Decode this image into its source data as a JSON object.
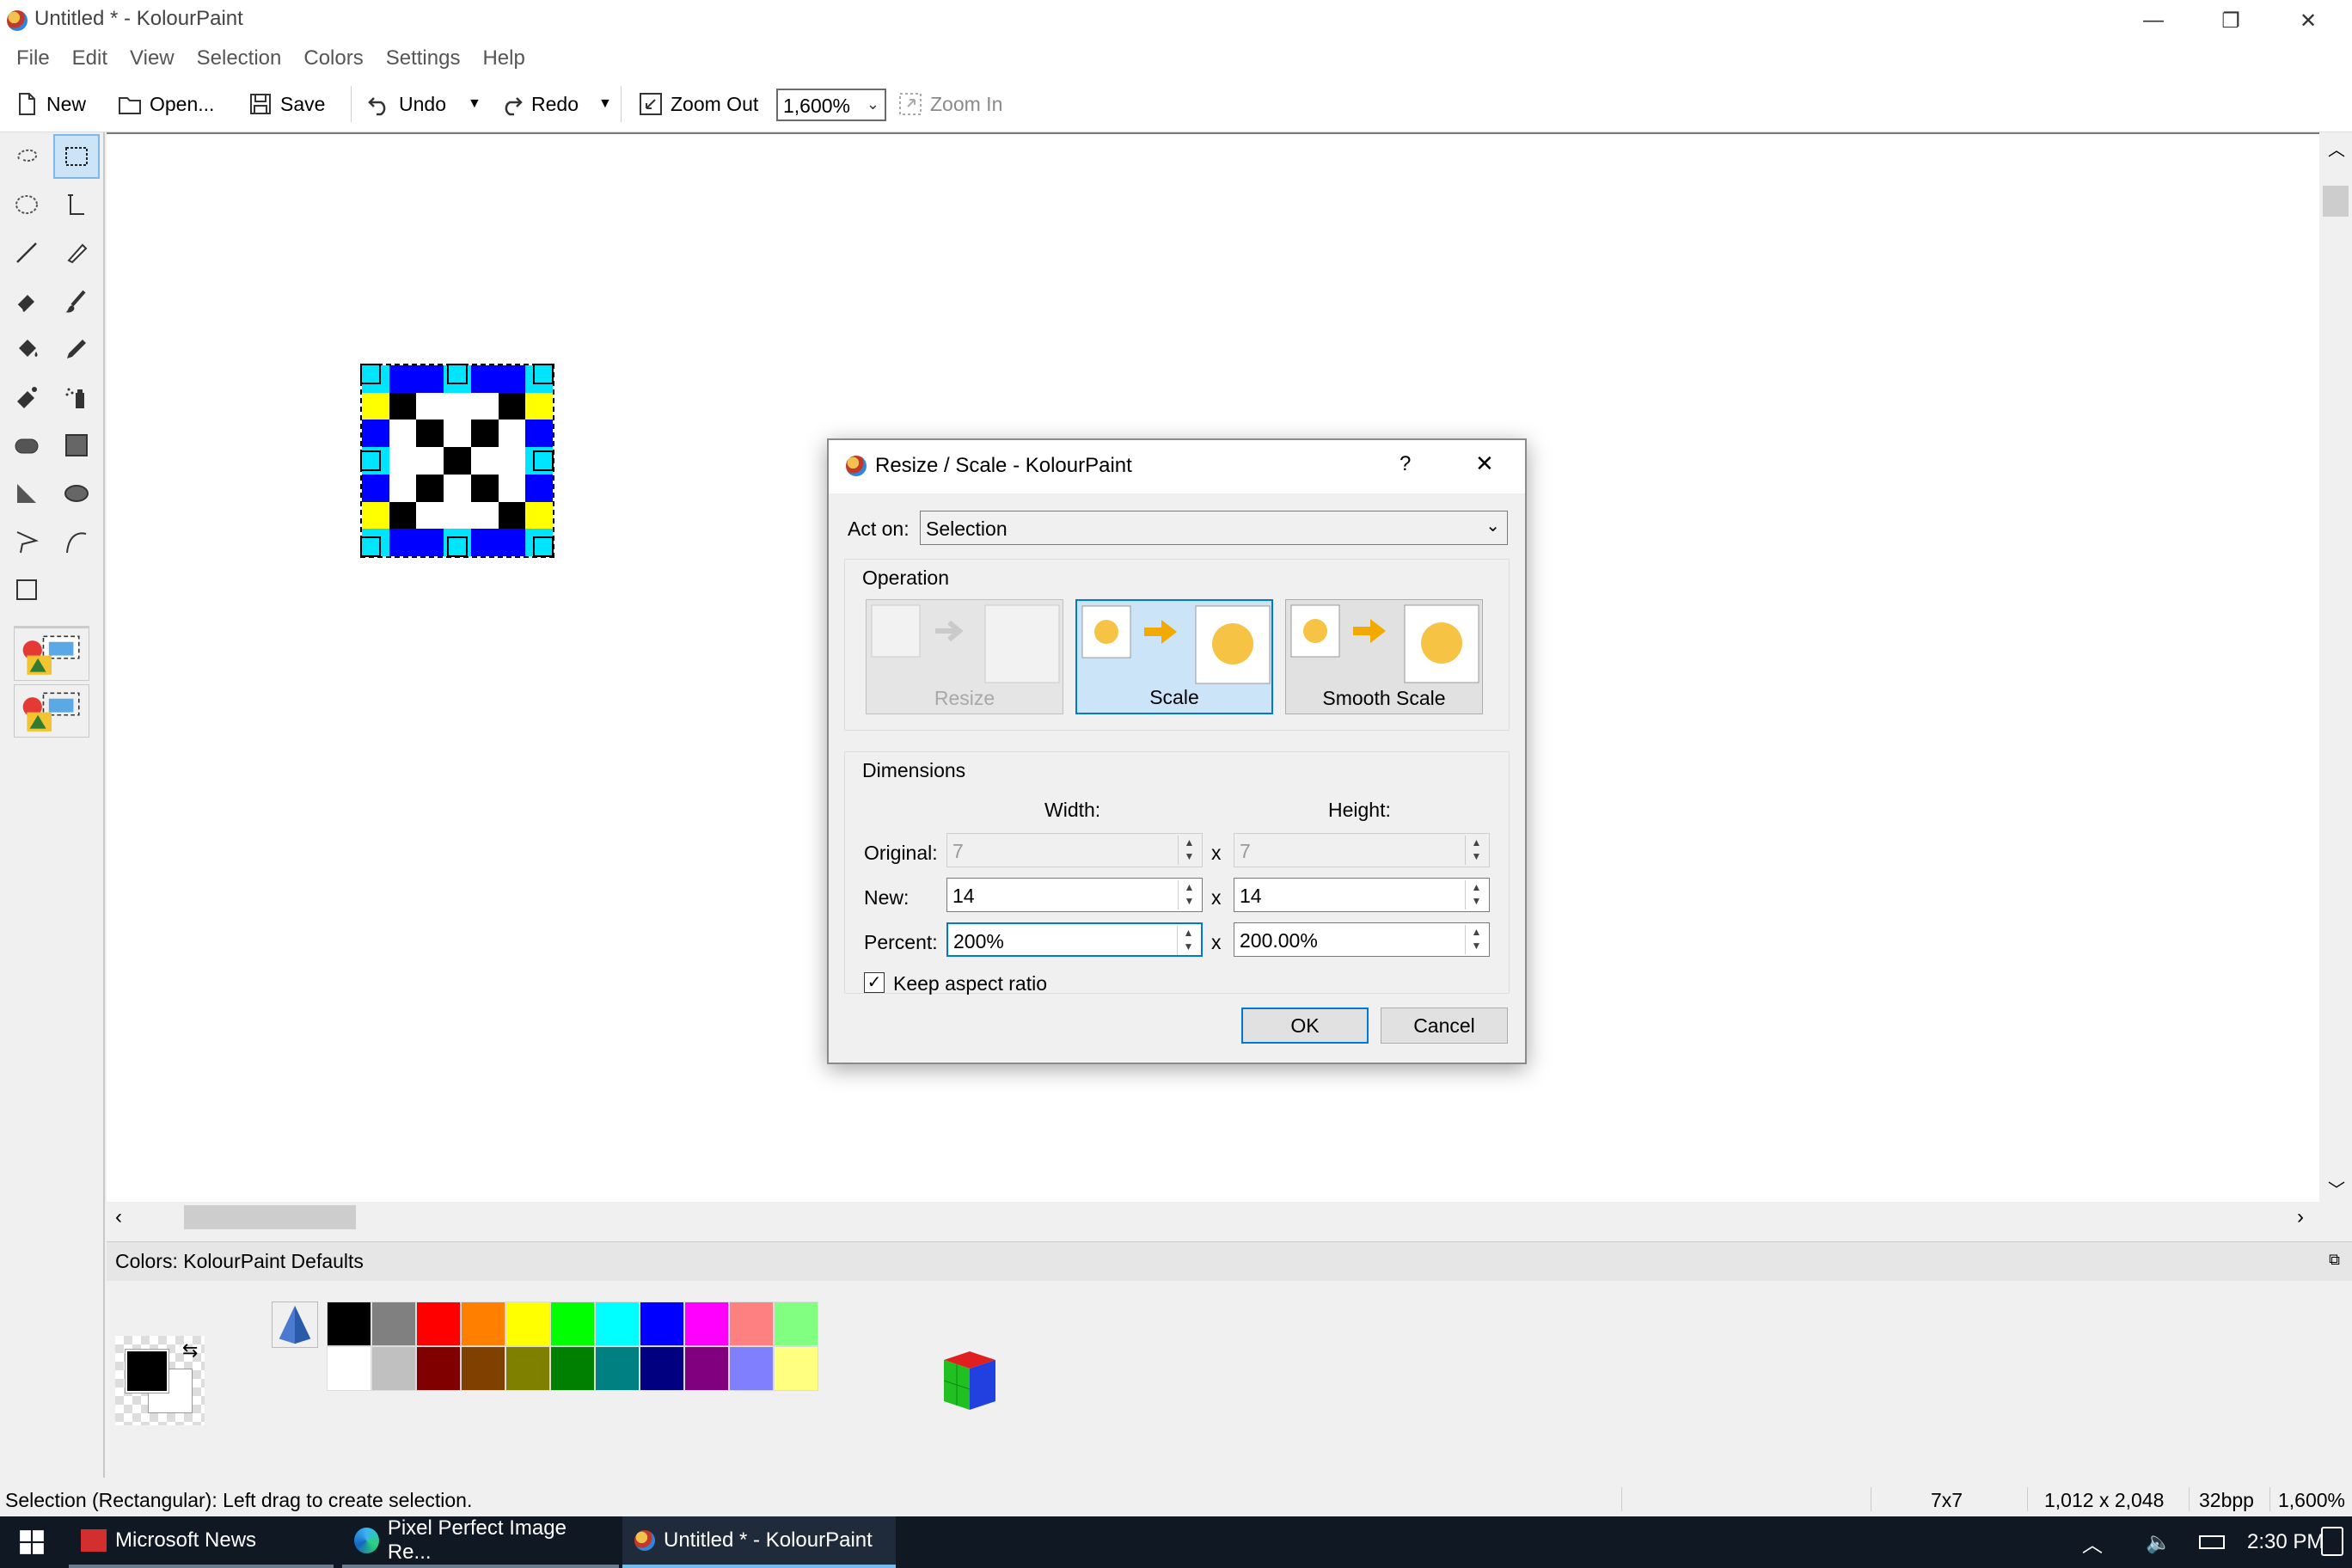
{
  "window": {
    "title": "Untitled * - KolourPaint",
    "minimize": "—",
    "restore": "❐",
    "close": "✕"
  },
  "menu": [
    "File",
    "Edit",
    "View",
    "Selection",
    "Colors",
    "Settings",
    "Help"
  ],
  "toolbar": {
    "new": "New",
    "open": "Open...",
    "save": "Save",
    "undo": "Undo",
    "redo": "Redo",
    "zoom_out": "Zoom Out",
    "zoom_value": "1,600%",
    "zoom_in": "Zoom In"
  },
  "image_pixels": [
    [
      "cyan",
      "blue",
      "blue",
      "cyan",
      "blue",
      "blue",
      "cyan"
    ],
    [
      "yellow",
      "black",
      "white",
      "white",
      "white",
      "black",
      "yellow"
    ],
    [
      "blue",
      "white",
      "black",
      "white",
      "black",
      "white",
      "blue"
    ],
    [
      "cyan",
      "white",
      "white",
      "black",
      "white",
      "white",
      "cyan"
    ],
    [
      "blue",
      "white",
      "black",
      "white",
      "black",
      "white",
      "blue"
    ],
    [
      "yellow",
      "black",
      "white",
      "white",
      "white",
      "black",
      "yellow"
    ],
    [
      "cyan",
      "blue",
      "blue",
      "cyan",
      "blue",
      "blue",
      "cyan"
    ]
  ],
  "dialog": {
    "title": "Resize / Scale - KolourPaint",
    "help": "?",
    "close": "✕",
    "act_on_label": "Act on:",
    "act_on_value": "Selection",
    "operation_label": "Operation",
    "op_resize": "Resize",
    "op_scale": "Scale",
    "op_smooth_scale": "Smooth Scale",
    "dimensions_label": "Dimensions",
    "width_header": "Width:",
    "height_header": "Height:",
    "original_label": "Original:",
    "new_label": "New:",
    "percent_label": "Percent:",
    "x": "x",
    "original_width": "7",
    "original_height": "7",
    "new_width": "14",
    "new_height": "14",
    "percent_width": "200%",
    "percent_height": "200.00%",
    "keep_aspect": "Keep aspect ratio",
    "ok": "OK",
    "cancel": "Cancel"
  },
  "colors_panel": {
    "title": "Colors: KolourPaint Defaults",
    "palette_top": [
      "#000000",
      "#808080",
      "#ff0000",
      "#ff8000",
      "#ffff00",
      "#00ff00",
      "#00ffff",
      "#0000ff",
      "#ff00ff",
      "#ff8080",
      "#80ff80"
    ],
    "palette_bottom": [
      "#ffffff",
      "#c0c0c0",
      "#800000",
      "#804000",
      "#808000",
      "#008000",
      "#008080",
      "#000080",
      "#800080",
      "#8080ff",
      "#ffff80"
    ]
  },
  "status": {
    "message": "Selection (Rectangular): Left drag to create selection.",
    "selection_size": "7x7",
    "image_size": "1,012 x 2,048",
    "depth": "32bpp",
    "zoom": "1,600%"
  },
  "taskbar": {
    "items": [
      "Microsoft News",
      "Pixel Perfect Image Re...",
      "Untitled * - KolourPaint"
    ],
    "time": "2:30 PM"
  }
}
